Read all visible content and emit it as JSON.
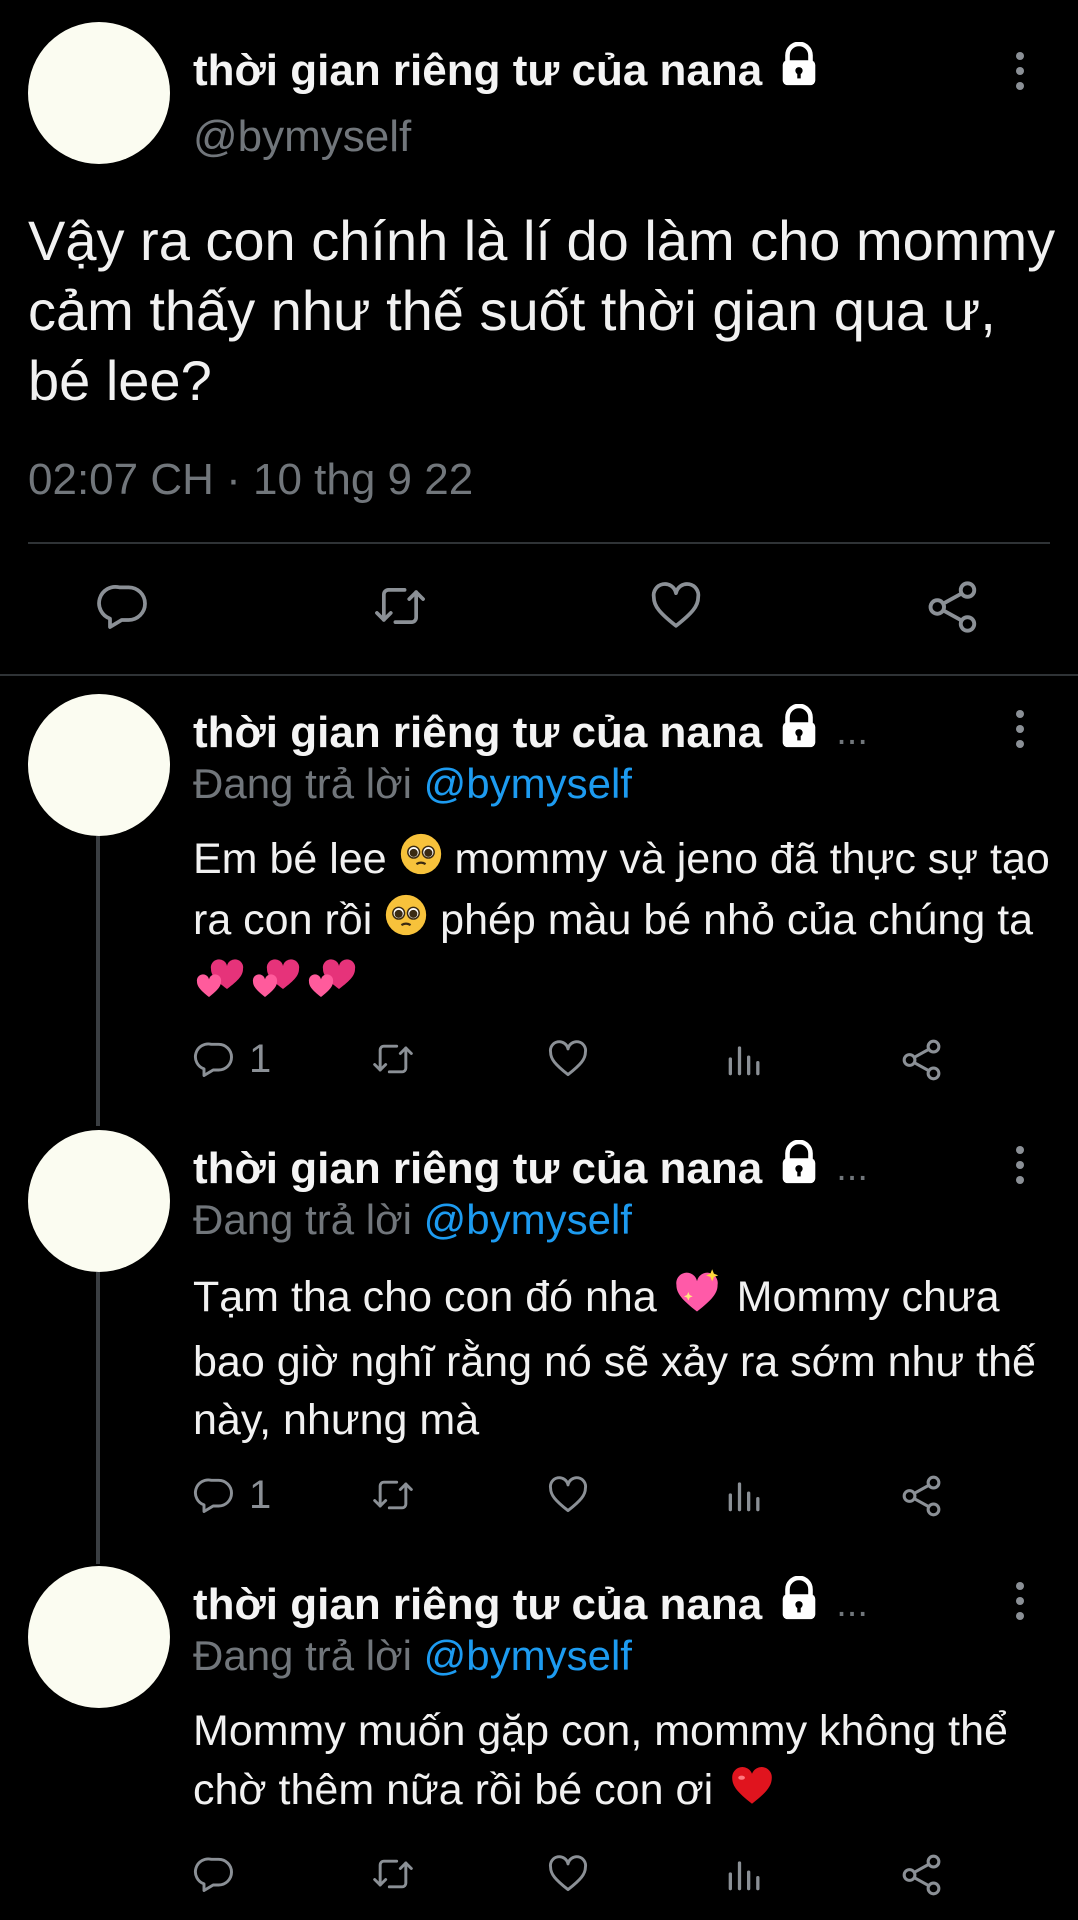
{
  "main_tweet": {
    "display_name": "thời gian riêng tư của nana",
    "handle": "@bymyself",
    "text": "Vậy ra con chính là lí do làm cho mommy cảm thấy như thế suốt thời gian qua ư, bé lee?",
    "timestamp": "02:07 CH · 10 thg 9 22",
    "actions": [
      "reply-icon",
      "retweet-icon",
      "like-icon",
      "share-icon"
    ]
  },
  "replies": [
    {
      "display_name": "thời gian riêng tư của nana",
      "more": "...",
      "replying_prefix": "Đang trả lời ",
      "replying_to": "@bymyself",
      "text_parts": [
        "Em bé lee ",
        " mommy và jeno đã thực sự tạo ra con rồi ",
        " phép màu bé nhỏ của chúng ta "
      ],
      "reply_count": "1"
    },
    {
      "display_name": "thời gian riêng tư của nana",
      "more": "...",
      "replying_prefix": "Đang trả lời ",
      "replying_to": "@bymyself",
      "text_parts": [
        "Tạm tha cho con đó nha ",
        " Mommy chưa bao giờ nghĩ rằng nó sẽ xảy ra sớm như thế này, nhưng mà"
      ],
      "reply_count": "1"
    },
    {
      "display_name": "thời gian riêng tư của nana",
      "more": "...",
      "replying_prefix": "Đang trả lời ",
      "replying_to": "@bymyself",
      "text_parts": [
        "Mommy muốn gặp con, mommy không thể chờ thêm nữa rồi bé con ơi "
      ],
      "reply_count": ""
    }
  ],
  "colors": {
    "background": "#000000",
    "text": "#e7e9ea",
    "muted": "#71767b",
    "link": "#1d9bf0",
    "avatar": "#fbfcf1"
  }
}
